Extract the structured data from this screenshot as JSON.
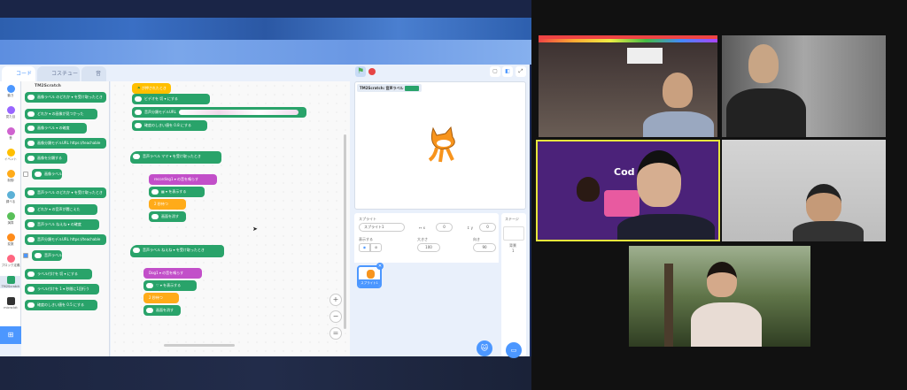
{
  "scratch": {
    "tabs": [
      "コード",
      "コスチューム",
      "音"
    ],
    "categories": [
      {
        "label": "動き",
        "color": "#4c97ff"
      },
      {
        "label": "見た目",
        "color": "#9966ff"
      },
      {
        "label": "音",
        "color": "#cf63cf"
      },
      {
        "label": "イベント",
        "color": "#ffbf00"
      },
      {
        "label": "制御",
        "color": "#ffab19"
      },
      {
        "label": "調べる",
        "color": "#5cb1d6"
      },
      {
        "label": "演算",
        "color": "#59c059"
      },
      {
        "label": "変数",
        "color": "#ff8c1a"
      },
      {
        "label": "ブロック定義",
        "color": "#ff6680"
      },
      {
        "label": "TM2Scratch",
        "color": "#29a36a"
      },
      {
        "label": "micro:bit",
        "color": "#333333"
      }
    ],
    "palette_title": "TM2Scratch",
    "palette_blocks": [
      "画像ラベル のどれか ▾ を受け取ったとき",
      "どれか ▾ の画像が見つかった",
      "画像ラベル ▾ の確度",
      "画像分類モデルURL https://teachable",
      "画像を分類する",
      "画像ラベル",
      "音声ラベル のどれか ▾ を受け取ったとき",
      "どれか ▾ の音声が聞こえた",
      "音声ラベル ねえね ▾ の確度",
      "音声分類モデルURL https://teachable",
      "音声ラベル",
      "ラベル付けを 切 ▾ にする",
      "ラベル付けを 1 ▾ 秒間に1回行う",
      "確度のしきい値を 0.5 にする"
    ],
    "scripts": {
      "flag_hat": "が押されたとき",
      "video": "ビデオを 切 ▾ にする",
      "model_url": "音声分類モデルURL",
      "threshold": "確度のしきい値を 0.8 にする",
      "hat1": "音声ラベル ママ ▾ を受け取ったとき",
      "sound1": "recording1 ▾ の音を鳴らす",
      "show1": "▦ ▾ を表示する",
      "wait1": "2 秒待つ",
      "clear1": "画面を消す",
      "hat2": "音声ラベル ねえね ▾ を受け取ったとき",
      "sound2": "Dog1 ▾ の音を鳴らす",
      "show2": "♡ ▾ を表示する",
      "wait2": "2 秒待つ",
      "clear2": "画面を消す"
    },
    "zoom_buttons": [
      "+",
      "−",
      "="
    ],
    "monitor_label": "TM2Scratch: 音声ラベル",
    "sprite": {
      "label": "スプライト",
      "name": "スプライト1",
      "x_label": "x",
      "x": "0",
      "y_label": "y",
      "y": "0",
      "show_label": "表示する",
      "size_label": "大きさ",
      "size": "100",
      "direction_label": "向き",
      "direction": "90",
      "thumb_label": "スプライト1"
    },
    "stage_panel": {
      "title": "ステージ",
      "backdrop_label": "背景",
      "backdrop_count": "1"
    }
  },
  "video_tiles": [
    {
      "id": "participant-1",
      "bg": "#4a3f3a"
    },
    {
      "id": "participant-2",
      "bg": "#8a8a8a"
    },
    {
      "id": "participant-3-active",
      "bg": "#4b2279",
      "active_border": "#e6e63c",
      "overlay_text": "Cod"
    },
    {
      "id": "participant-4",
      "bg": "#cfcfcf"
    },
    {
      "id": "participant-5",
      "bg": "#6b7f4e"
    }
  ]
}
